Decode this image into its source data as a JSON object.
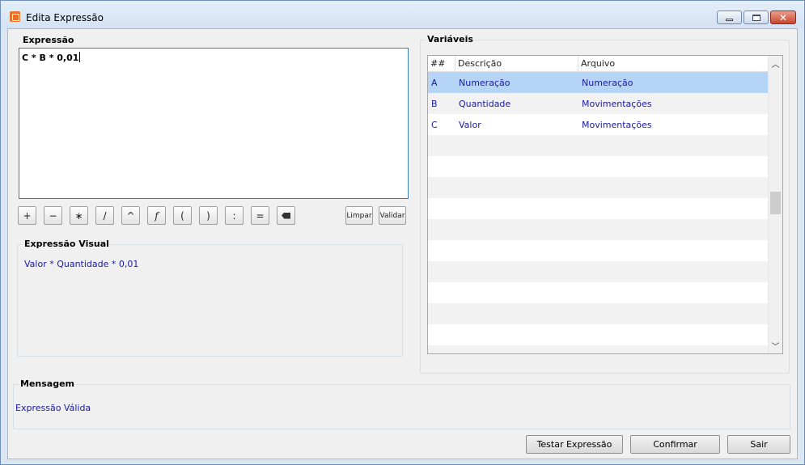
{
  "window": {
    "title": "Edita Expressão"
  },
  "expression": {
    "group_title": "Expressão",
    "value": "C * B * 0,01"
  },
  "operators": [
    {
      "name": "plus",
      "label": "+"
    },
    {
      "name": "minus",
      "label": "−"
    },
    {
      "name": "multiply",
      "label": "∗"
    },
    {
      "name": "divide",
      "label": "/"
    },
    {
      "name": "power",
      "label": "^"
    },
    {
      "name": "function",
      "label": "f"
    },
    {
      "name": "open-paren",
      "label": "("
    },
    {
      "name": "close-paren",
      "label": ")"
    },
    {
      "name": "colon",
      "label": ":"
    },
    {
      "name": "equals",
      "label": "="
    }
  ],
  "buttons": {
    "clear": "Limpar",
    "validate": "Validar",
    "test": "Testar Expressão",
    "confirm": "Confirmar",
    "exit": "Sair"
  },
  "visual": {
    "group_title": "Expressão Visual",
    "text": "Valor * Quantidade * 0,01"
  },
  "variables": {
    "group_title": "Variáveis",
    "columns": [
      "##",
      "Descrição",
      "Arquivo"
    ],
    "rows": [
      {
        "id": "A",
        "descricao": "Numeração",
        "arquivo": "Numeração",
        "selected": true
      },
      {
        "id": "B",
        "descricao": "Quantidade",
        "arquivo": "Movimentações",
        "selected": false
      },
      {
        "id": "C",
        "descricao": "Valor",
        "arquivo": "Movimentações",
        "selected": false
      }
    ]
  },
  "message": {
    "group_title": "Mensagem",
    "text": "Expressão Válida"
  },
  "colors": {
    "value_text": "#1a1aa0",
    "selected_row": "#b6d5f6"
  }
}
